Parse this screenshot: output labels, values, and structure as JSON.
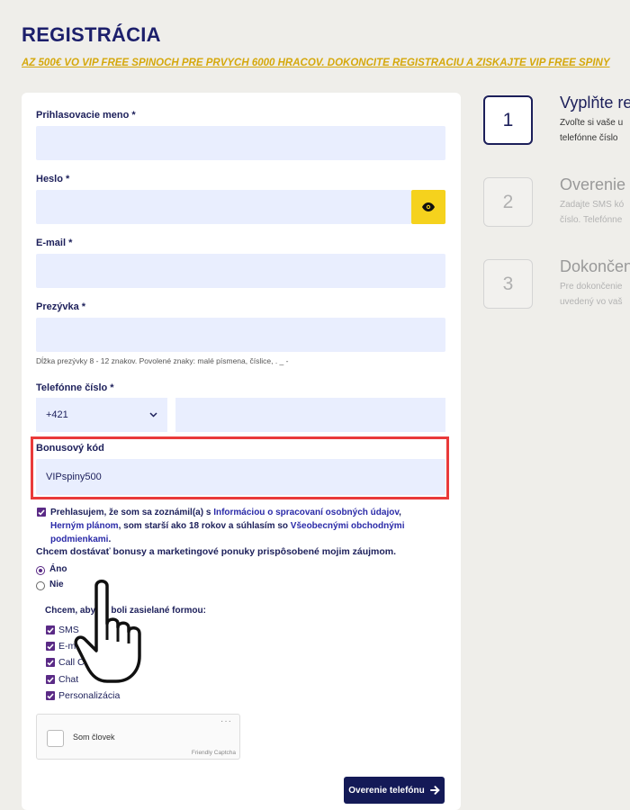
{
  "page": {
    "title": "REGISTRÁCIA",
    "promo": "AŽ 500€ VO VIP FREE SPINOCH PRE PRVÝCH 6000 HRÁČOV. DOKONČITE REGISTRÁCIU A ZÍSKAJTE VIP FREE SPINY"
  },
  "form": {
    "username_label": "Prihlasovacie meno *",
    "password_label": "Heslo *",
    "email_label": "E-mail *",
    "nickname_label": "Prezývka *",
    "nickname_hint": "Dĺžka prezývky 8 - 12 znakov. Povolené znaky: malé písmena, číslice, . _ -",
    "phone_label": "Telefónne číslo *",
    "phone_prefix": "+421",
    "bonus_label": "Bonusový kód",
    "bonus_value": "VIPspiny500",
    "consent_part1": "Prehlasujem, že som sa zoznámil(a) s ",
    "consent_link1": "Informáciou o spracovaní osobných údajov",
    "consent_part2": ", ",
    "consent_link2": "Herným plánom",
    "consent_part3": ", som starší ako 18 rokov a súhlasím so ",
    "consent_link3": "Všeobecnými obchodnými podmienkami",
    "consent_part4": ".",
    "offers_question": "Chcem dostávať bonusy a marketingové ponuky prispôsobené mojim záujmom.",
    "offers_yes": "Áno",
    "offers_no": "Nie",
    "offers_selected": "Áno",
    "channels_title": "Chcem, aby mi boli zasielané formou:",
    "channels": [
      "SMS",
      "E-mail",
      "Call Centrum",
      "Chat",
      "Personalizácia"
    ],
    "captcha_label": "Som človek",
    "captcha_brand": "Friendly Captcha",
    "captcha_menu": "···",
    "submit_label": "Overenie telefónu"
  },
  "steps": [
    {
      "number": "1",
      "title": "Vyplňte re",
      "desc1": "Zvoľte si vaše u",
      "desc2": "telefónne číslo",
      "active": true
    },
    {
      "number": "2",
      "title": "Overenie t",
      "desc1": "Zadajte SMS kó",
      "desc2": "číslo. Telefónne",
      "active": false
    },
    {
      "number": "3",
      "title": "Dokončen",
      "desc1": "Pre dokončenie",
      "desc2": "uvedený vo vaš",
      "active": false
    }
  ],
  "colors": {
    "accent_yellow": "#f5d21d",
    "navy": "#141a57",
    "highlight_red": "#e93a3a",
    "input_bg": "#e9eefe",
    "checkbox_purple": "#5a2a86"
  }
}
